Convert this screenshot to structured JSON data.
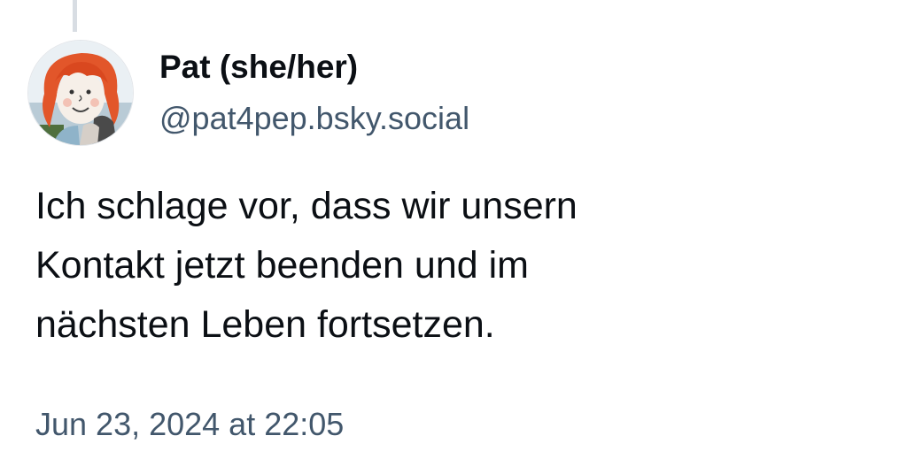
{
  "post": {
    "author": {
      "display_name": "Pat (she/her)",
      "handle": "@pat4pep.bsky.social",
      "avatar_icon": "avatar-drawing-red-hair-person"
    },
    "text_lines": [
      "Ich schlage vor, dass wir unsern",
      "Kontakt jetzt beenden und im",
      "nächsten Leben fortsetzen."
    ],
    "timestamp": "Jun 23, 2024 at 22:05"
  },
  "colors": {
    "text_primary": "#0b0f14",
    "text_secondary": "#42576c",
    "thread_line": "#d8dde3",
    "background": "#ffffff"
  }
}
